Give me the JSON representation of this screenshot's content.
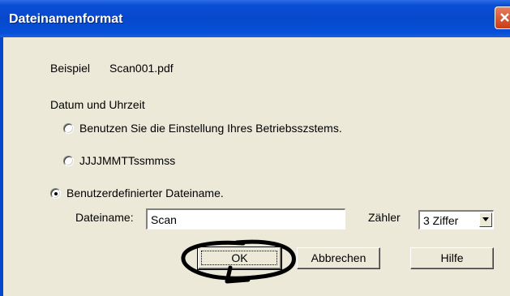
{
  "window": {
    "title": "Dateinamenformat"
  },
  "example": {
    "label": "Beispiel",
    "value": "Scan001.pdf"
  },
  "date_time": {
    "heading": "Datum und Uhrzeit",
    "options": [
      {
        "label": "Benutzen Sie die Einstellung Ihres Betriebsszstems.",
        "selected": false
      },
      {
        "label": "JJJJMMTTssmmss",
        "selected": false
      }
    ]
  },
  "custom": {
    "label": "Benutzerdefinierter Dateiname.",
    "selected": true,
    "filename_label": "Dateiname:",
    "filename_value": "Scan",
    "counter_label": "Zähler",
    "counter_value": "3 Ziffer"
  },
  "buttons": {
    "ok": "OK",
    "cancel": "Abbrechen",
    "help": "Hilfe"
  },
  "annotation": {
    "color": "#000000",
    "shape": "hand-drawn circle around OK button"
  }
}
